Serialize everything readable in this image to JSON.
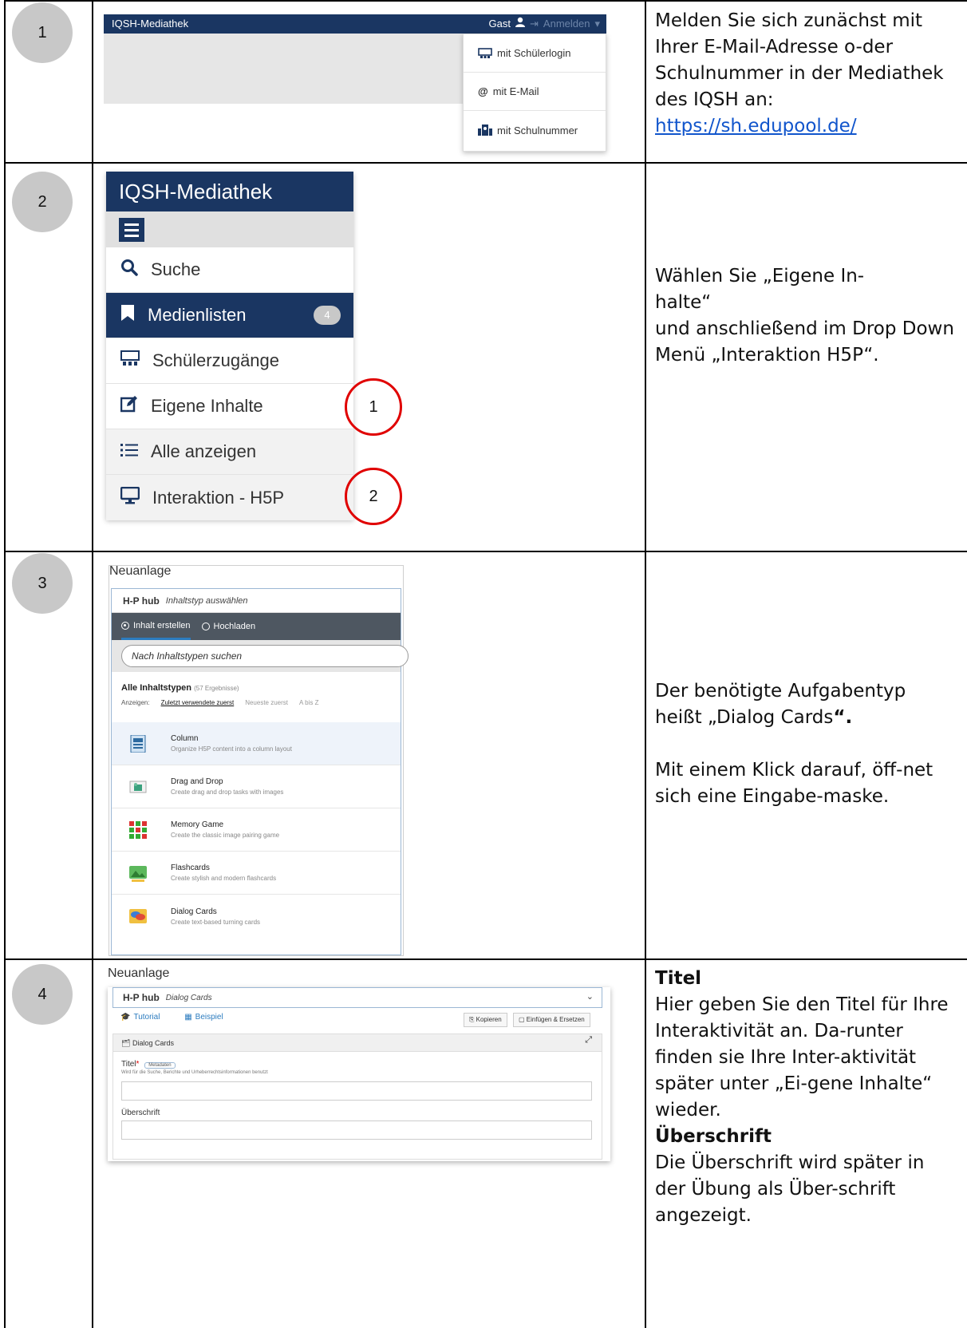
{
  "rows": [
    {
      "number": "1",
      "screenshot": {
        "brand": "IQSH-Mediathek",
        "guest_label": "Gast",
        "login_label": "Anmelden",
        "menu_items": [
          "mit Schülerlogin",
          "mit E-Mail",
          "mit Schulnummer"
        ]
      },
      "text": "Melden Sie sich zunächst mit Ihrer E-Mail-Adresse o-der Schulnummer in der Mediathek des IQSH an:",
      "link": "https://sh.edupool.de/"
    },
    {
      "number": "2",
      "screenshot": {
        "brand": "IQSH-Mediathek",
        "items": [
          {
            "label": "Suche",
            "icon": "search-icon"
          },
          {
            "label": "Medienlisten",
            "icon": "bookmark-icon",
            "badge": "4"
          },
          {
            "label": "Schülerzugänge",
            "icon": "students-icon"
          },
          {
            "label": "Eigene Inhalte",
            "icon": "edit-icon"
          },
          {
            "label": "Alle anzeigen",
            "icon": "list-icon"
          },
          {
            "label": "Interaktion - H5P",
            "icon": "monitor-icon"
          }
        ],
        "markers": [
          "1",
          "2"
        ]
      },
      "text_lines": [
        "Wählen Sie „Eigene In-",
        "halte“",
        "und anschließend im Drop Down Menü „Interaktion H5P“."
      ]
    },
    {
      "number": "3",
      "screenshot": {
        "title": "Neuanlage",
        "hub_logo": "H-P hub",
        "hub_caption": "Inhaltstyp auswählen",
        "tab_create": "Inhalt erstellen",
        "tab_upload": "Hochladen",
        "search_placeholder": "Nach Inhaltstypen suchen",
        "all_types": "Alle Inhaltstypen",
        "result_count": "(57 Ergebnisse)",
        "show_label": "Anzeigen:",
        "sort_recent": "Zuletzt verwendete zuerst",
        "sort_newest": "Neueste zuerst",
        "sort_az": "A bis Z",
        "types": [
          {
            "name": "Column",
            "desc": "Organize H5P content into a column layout",
            "icon": "column-icon"
          },
          {
            "name": "Drag and Drop",
            "desc": "Create drag and drop tasks with images",
            "icon": "drag-drop-icon"
          },
          {
            "name": "Memory Game",
            "desc": "Create the classic image pairing game",
            "icon": "memory-game-icon"
          },
          {
            "name": "Flashcards",
            "desc": "Create stylish and modern flashcards",
            "icon": "flashcards-icon"
          },
          {
            "name": "Dialog Cards",
            "desc": "Create text-based turning cards",
            "icon": "dialog-cards-icon"
          }
        ]
      },
      "text_a": "Der benötigte Aufgabentyp heißt „Dialog Cards",
      "text_a_quote": "“.",
      "text_b": "Mit einem Klick darauf, öff-net sich eine Eingabe-maske."
    },
    {
      "number": "4",
      "screenshot": {
        "title": "Neuanlage",
        "hub_logo": "H-P hub",
        "selected_type": "Dialog Cards",
        "tutorial": "Tutorial",
        "example": "Beispiel",
        "copy": "Kopieren",
        "paste": "Einfügen & Ersetzen",
        "group_title": "Dialog Cards",
        "field_title": "Titel",
        "metadata": "Metadaten",
        "field_hint": "Wird für die Suche, Berichte und Urheberrechtsinformationen benutzt",
        "field_heading": "Überschrift"
      },
      "h1": "Titel",
      "p1": "Hier geben Sie den Titel für Ihre Interaktivität an. Da-runter finden sie Ihre Inter-aktivität später unter „Ei-gene Inhalte“ wieder.",
      "h2": "Überschrift",
      "p2": "Die Überschrift wird später in der Übung als Über-schrift angezeigt."
    }
  ],
  "colors": {
    "navy": "#1a3662",
    "marker_red": "#e00000",
    "link_blue": "#1155cc"
  }
}
